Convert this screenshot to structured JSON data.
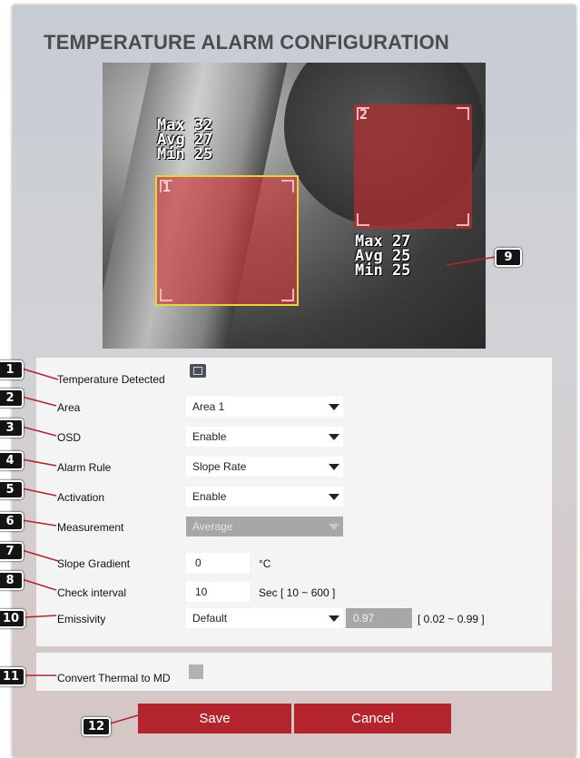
{
  "title": "TEMPERATURE ALARM CONFIGURATION",
  "thermal": {
    "area1": {
      "num": "1",
      "osd": "Max 32\nAvg 27\nMin 25"
    },
    "area2": {
      "num": "2",
      "osd": "Max 27\nAvg 25\nMin 25"
    }
  },
  "form": {
    "temperature_detected": {
      "label": "Temperature Detected",
      "icon": "thermal-camera-icon"
    },
    "area": {
      "label": "Area",
      "value": "Area 1"
    },
    "osd": {
      "label": "OSD",
      "value": "Enable"
    },
    "alarm_rule": {
      "label": "Alarm Rule",
      "value": "Slope Rate"
    },
    "activation": {
      "label": "Activation",
      "value": "Enable"
    },
    "measurement": {
      "label": "Measurement",
      "value": "Average"
    },
    "slope_gradient": {
      "label": "Slope Gradient",
      "value": "0",
      "unit": "°C"
    },
    "check_interval": {
      "label": "Check interval",
      "value": "10",
      "unit": "Sec [ 10 ~ 600 ]"
    },
    "emissivity": {
      "label": "Emissivity",
      "value": "Default",
      "number": "0.97",
      "range": "[ 0.02 ~ 0.99 ]"
    },
    "convert": {
      "label": "Convert Thermal to MD"
    }
  },
  "buttons": {
    "save": "Save",
    "cancel": "Cancel"
  },
  "badges": [
    "1",
    "2",
    "3",
    "4",
    "5",
    "6",
    "7",
    "8",
    "9",
    "10",
    "11",
    "12"
  ],
  "colors": {
    "button": "#b3242d",
    "area_fill": "#cd373c",
    "area1_border": "#e8d23a"
  }
}
